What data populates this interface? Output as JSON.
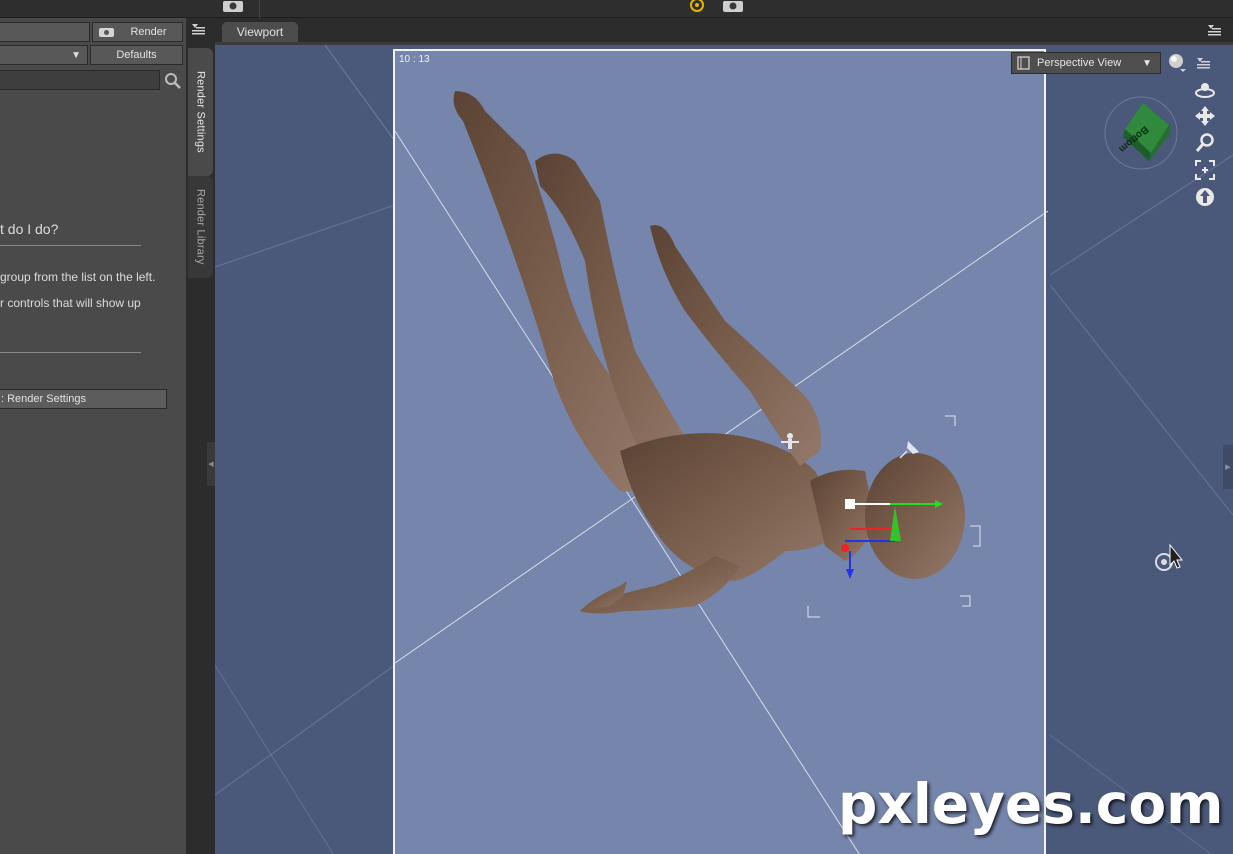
{
  "toolbar": {
    "icons": [
      "camera-icon",
      "orbit-gizmo-icon",
      "camera-icon"
    ]
  },
  "left_panel": {
    "render_button": "Render",
    "defaults_button": "Defaults",
    "heading": "t do I do?",
    "line1": "group from the list on the left.",
    "line2": "r controls that will show up",
    "render_settings_button": ": Render Settings"
  },
  "side_tabs": {
    "tab1": "Render Settings",
    "tab2": "Render Library"
  },
  "viewport": {
    "tab_label": "Viewport",
    "frame_label": "10 : 13",
    "view_dropdown": "Perspective View",
    "cube_label": "Bottom"
  },
  "colors": {
    "viewport_bg": "#4a5879",
    "frame_bg": "#7585ab",
    "panel_bg": "#4a4a4a",
    "accent_yellow": "#e8b400"
  },
  "watermark": "pxleyes.com"
}
